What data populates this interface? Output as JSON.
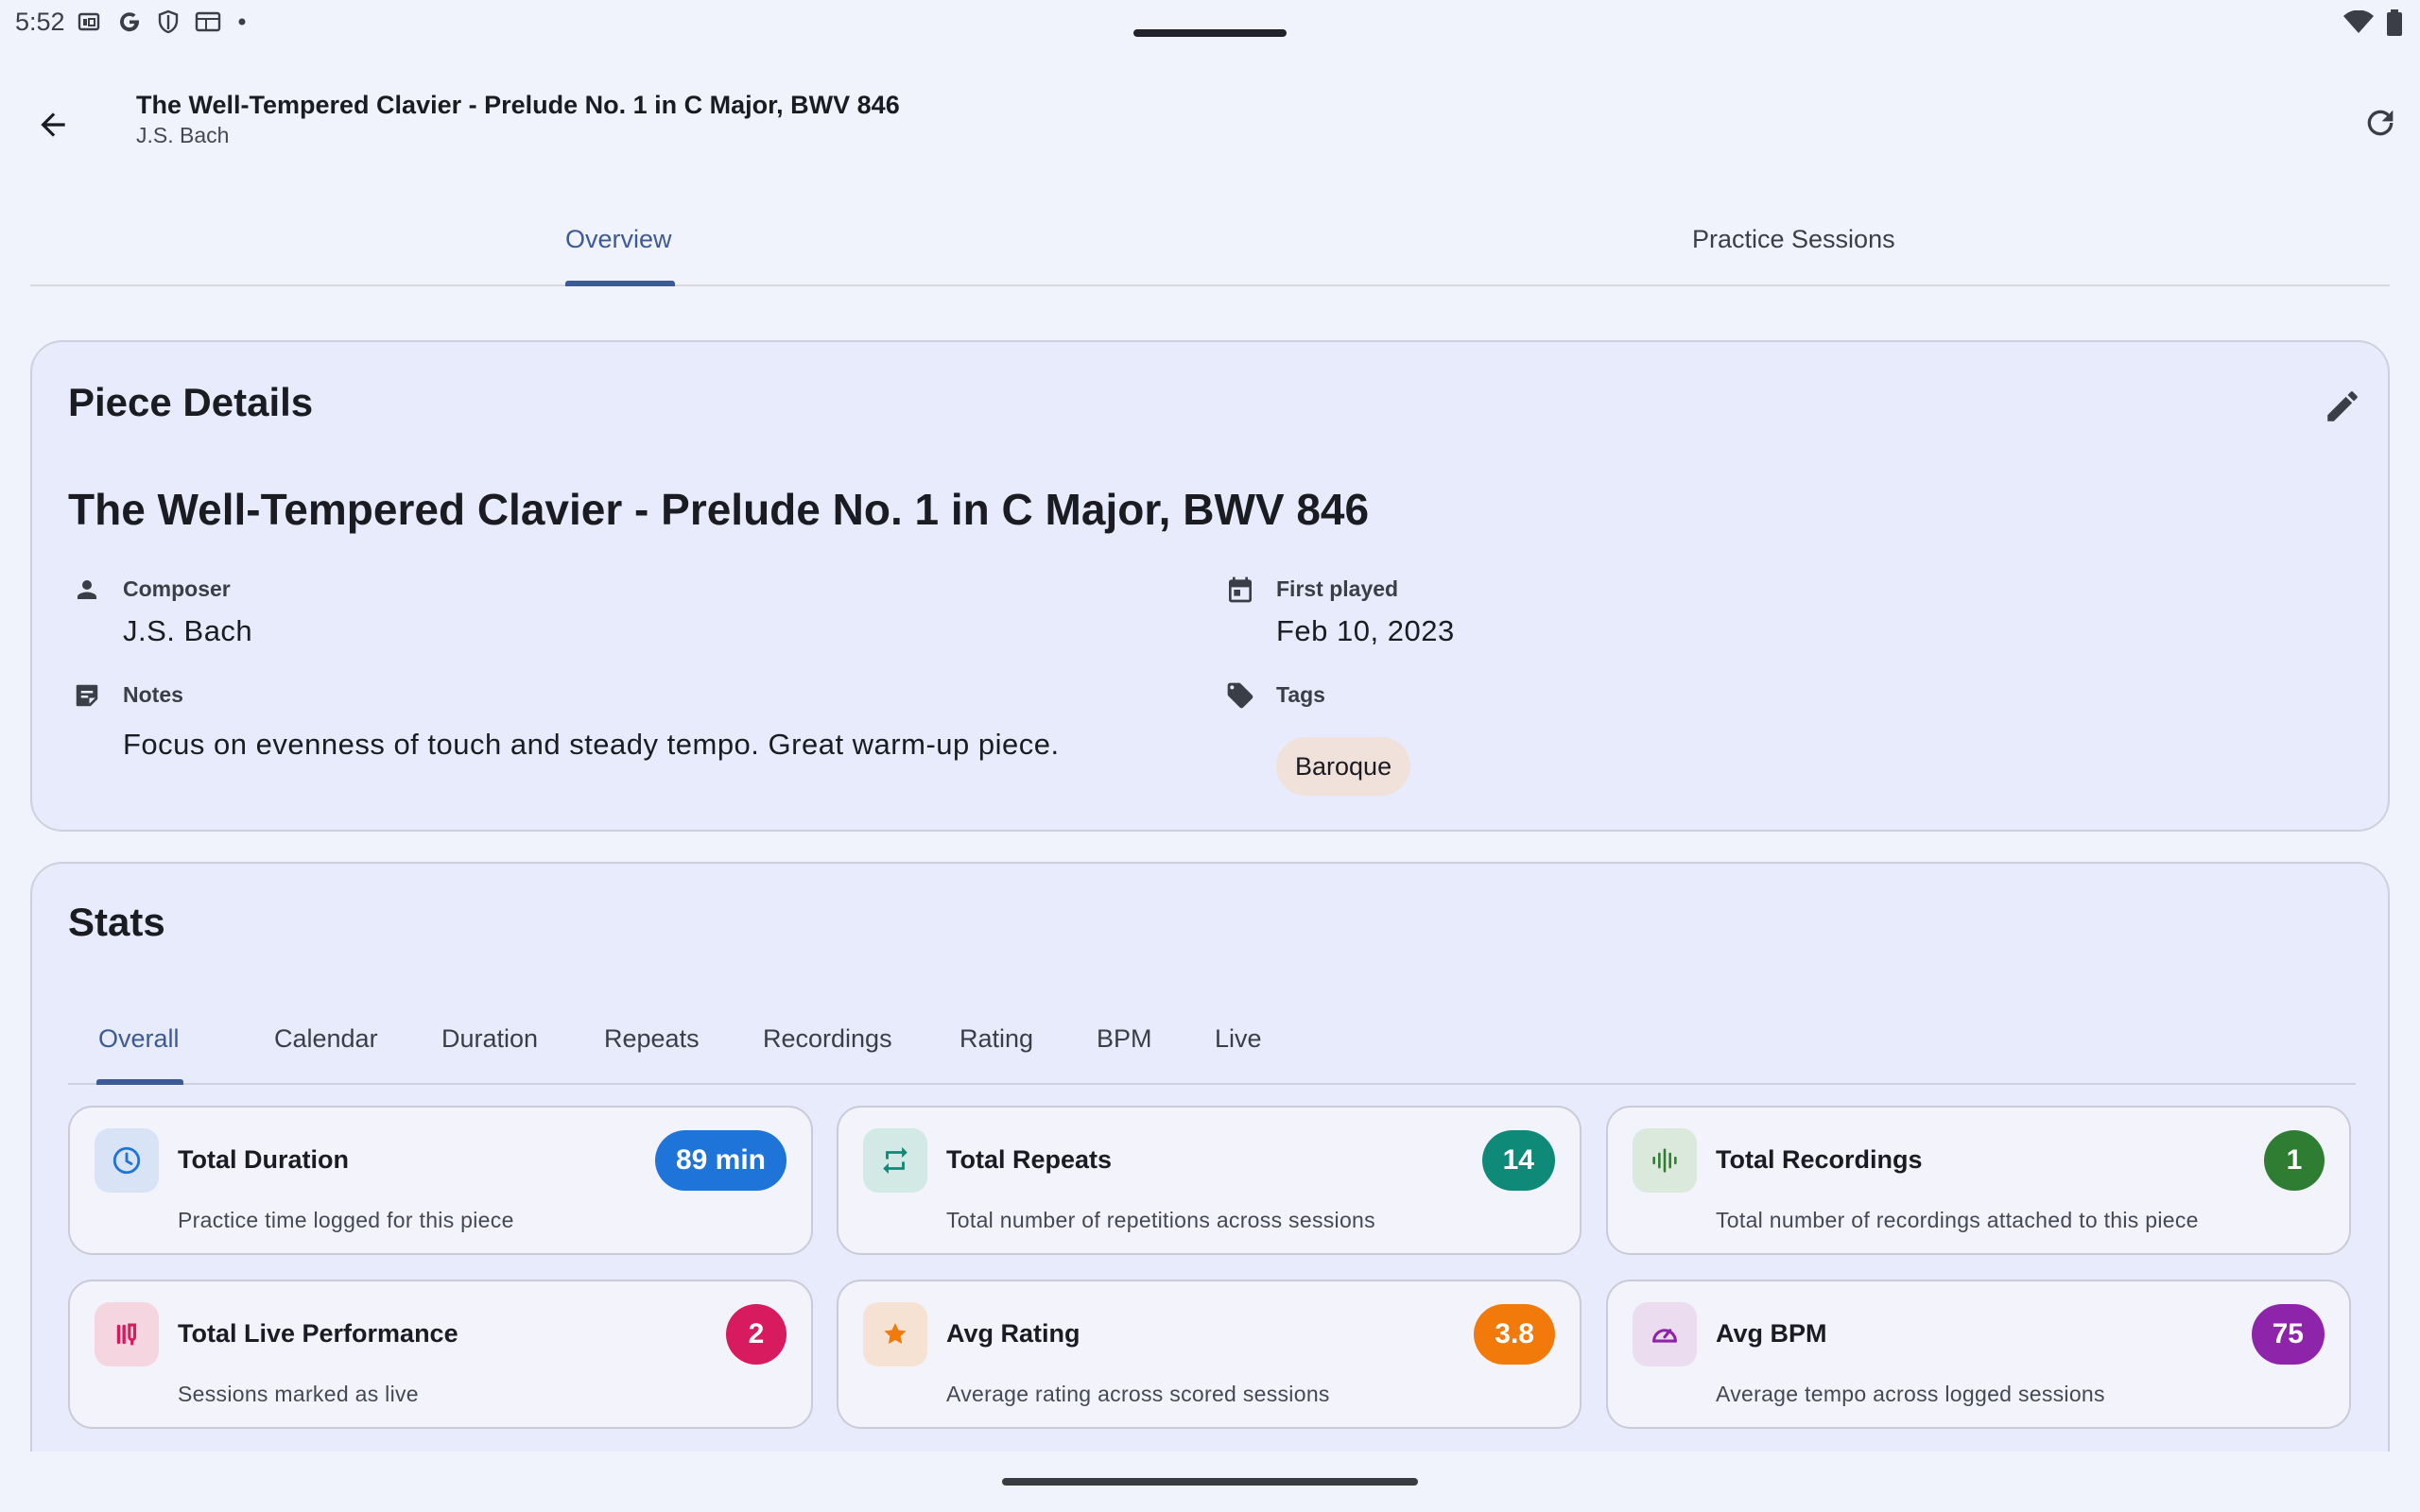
{
  "status_bar": {
    "time": "5:52"
  },
  "app_bar": {
    "title": "The Well-Tempered Clavier - Prelude No. 1 in C Major, BWV 846",
    "subtitle": "J.S. Bach"
  },
  "tabs": [
    {
      "label": "Overview",
      "active": true
    },
    {
      "label": "Practice Sessions",
      "active": false
    }
  ],
  "piece_details": {
    "heading": "Piece Details",
    "title": "The Well-Tempered Clavier - Prelude No. 1 in C Major, BWV 846",
    "composer_label": "Composer",
    "composer": "J.S. Bach",
    "first_played_label": "First played",
    "first_played": "Feb 10, 2023",
    "notes_label": "Notes",
    "notes": "Focus on evenness of touch and steady tempo. Great warm-up piece.",
    "tags_label": "Tags",
    "tags": [
      "Baroque"
    ]
  },
  "stats": {
    "heading": "Stats",
    "tabs": [
      "Overview",
      "Calendar",
      "Duration",
      "Repeats",
      "Recordings",
      "Rating",
      "BPM",
      "Live"
    ],
    "tabs_display": [
      "Overall",
      "Calendar",
      "Duration",
      "Repeats",
      "Recordings",
      "Rating",
      "BPM",
      "Live"
    ],
    "active_tab": "Overall",
    "tiles": [
      {
        "title": "Total Duration",
        "value": "89 min",
        "description": "Practice time logged for this piece",
        "icon": "clock-icon",
        "color": "#1e74d9",
        "icon_bg": "#d8e4f6"
      },
      {
        "title": "Total Repeats",
        "value": "14",
        "description": "Total number of repetitions across sessions",
        "icon": "repeat-icon",
        "color": "#0f8a78",
        "icon_bg": "#d3e9e6"
      },
      {
        "title": "Total Recordings",
        "value": "1",
        "description": "Total number of recordings attached to this piece",
        "icon": "audio-wave-icon",
        "color": "#2e7d32",
        "icon_bg": "#dbe8dc"
      },
      {
        "title": "Total Live Performance",
        "value": "2",
        "description": "Sessions marked as live",
        "icon": "microphone-icon",
        "color": "#d81b5e",
        "icon_bg": "#f5d6e0"
      },
      {
        "title": "Avg Rating",
        "value": "3.8",
        "description": "Average rating across scored sessions",
        "icon": "star-icon",
        "color": "#f17a0a",
        "icon_bg": "#f6e2d2"
      },
      {
        "title": "Avg BPM",
        "value": "75",
        "description": "Average tempo across logged sessions",
        "icon": "speedometer-icon",
        "color": "#8e24aa",
        "icon_bg": "#ecdcef"
      }
    ]
  },
  "colors": {
    "accent": "#3c5a96",
    "background": "#f1f3fc",
    "card": "#e7ebfb",
    "tag_chip": "#f0e2da"
  }
}
